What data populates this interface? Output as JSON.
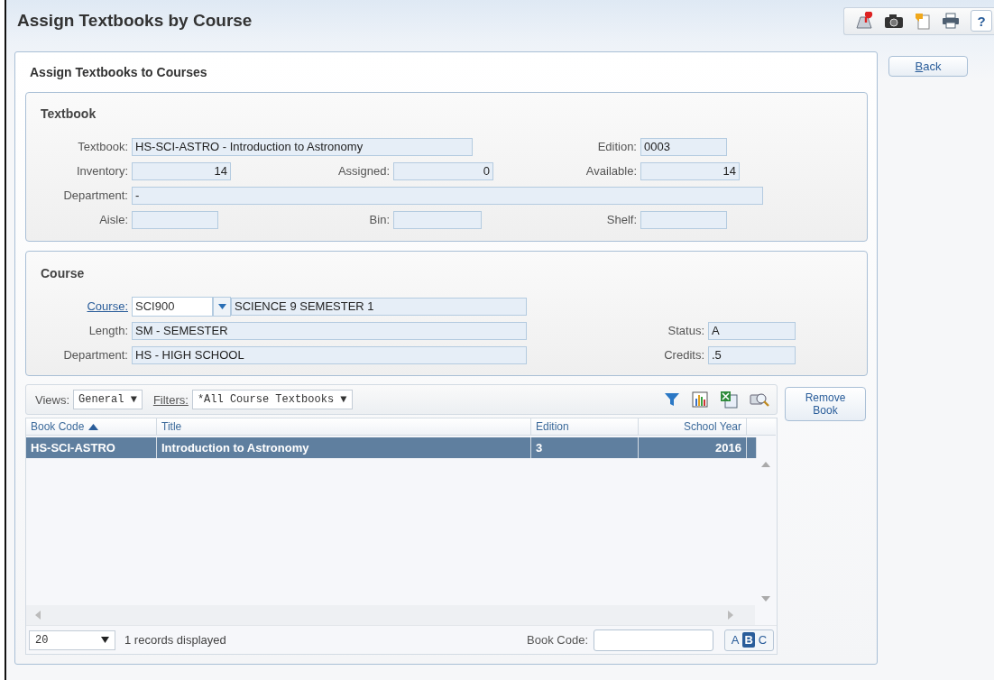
{
  "window": {
    "title": "Assign Textbooks by Course",
    "help_button": "?"
  },
  "page": {
    "title": "Assign Textbooks to Courses",
    "back_button": "Back"
  },
  "textbook": {
    "title": "Textbook",
    "rows": [
      [
        {
          "label": "Textbook:",
          "value": "HS-SCI-ASTRO - Introduction to Astronomy",
          "kind": "text"
        },
        "",
        {
          "label": "Edition:",
          "value": "0003",
          "kind": "text"
        }
      ],
      [
        {
          "label": "Inventory:",
          "value": "14",
          "kind": "number"
        },
        {
          "label": "Assigned:",
          "value": "0",
          "kind": "number"
        },
        {
          "label": "Available:",
          "value": "14",
          "kind": "number"
        }
      ],
      [
        {
          "label": "Department:",
          "value": "-",
          "kind": "text"
        }
      ],
      [
        {
          "label": "Aisle:",
          "kind": "text"
        },
        {
          "label": "Bin:",
          "kind": "text"
        },
        {
          "label": "Shelf:",
          "kind": "text"
        }
      ]
    ]
  },
  "course": {
    "title": "Course",
    "rows": [
      [
        {
          "label": "Course:",
          "value": "SCI900",
          "description": "SCIENCE 9 SEMESTER 1",
          "kind": "lookup"
        }
      ],
      [
        {
          "label": "Length:",
          "value": "SM - SEMESTER",
          "kind": "text"
        },
        {
          "label": "Status:",
          "value": "A",
          "kind": "text"
        }
      ],
      [
        {
          "label": "Department:",
          "value": "HS - HIGH SCHOOL",
          "kind": "text"
        },
        {
          "label": "Credits:",
          "value": ".5",
          "kind": "text"
        }
      ]
    ]
  },
  "grid": {
    "views": {
      "label": "Views:",
      "value": "General ▼"
    },
    "filters": {
      "label": "Filters:",
      "value": "*All Course Textbooks ▼"
    },
    "columns": [
      {
        "label": "Book Code",
        "sorted": true
      },
      {
        "label": "Title",
        "sorted": false
      },
      {
        "label": "Edition",
        "sorted": false
      },
      {
        "label": "School Year",
        "sorted": false
      }
    ],
    "rows": [
      {
        "selected": true,
        "cells": [
          "HS-SCI-ASTRO",
          "Introduction to Astronomy",
          "3",
          "2016"
        ]
      }
    ],
    "page_size": "20",
    "records": "1 records displayed",
    "search": {
      "label": "Book Code:"
    },
    "letters": [
      {
        "label": "A",
        "selected": false
      },
      {
        "label": "B",
        "selected": true
      },
      {
        "label": "C",
        "selected": false
      }
    ]
  },
  "remove_button": "Remove Book"
}
